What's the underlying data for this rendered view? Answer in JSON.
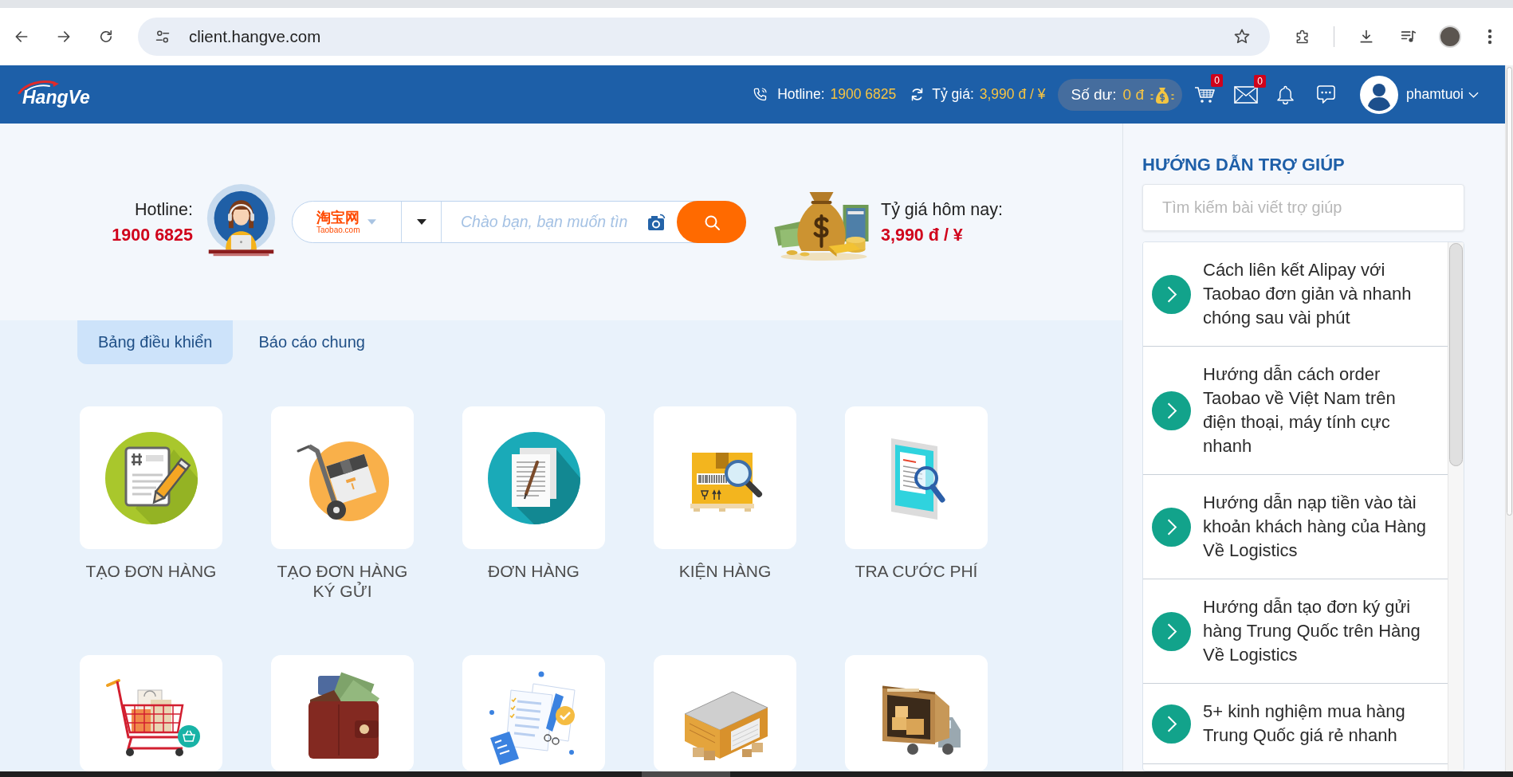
{
  "browser": {
    "url": "client.hangve.com"
  },
  "header": {
    "logo": "HangVe",
    "hotline_label": "Hotline:",
    "hotline": "1900 6825",
    "rate_label": "Tỷ giá:",
    "rate": "3,990 đ / ¥",
    "balance_label": "Số dư:",
    "balance": "0 đ",
    "cart_count": "0",
    "mail_count": "0",
    "username": "phamtuoi"
  },
  "hero": {
    "hotline_label": "Hotline:",
    "hotline": "1900 6825",
    "store_name": "淘宝网",
    "store_domain": "Taobao.com",
    "search_placeholder": "Chào bạn, bạn muốn tìn",
    "rate_label": "Tỷ giá hôm nay:",
    "rate": "3,990 đ / ¥"
  },
  "tabs": [
    {
      "label": "Bảng điều khiển",
      "selected": true
    },
    {
      "label": "Báo cáo chung",
      "selected": false
    }
  ],
  "tiles": [
    {
      "kind": "note",
      "label": "TẠO ĐƠN HÀNG"
    },
    {
      "kind": "hand-truck",
      "label": "TẠO ĐƠN HÀNG KÝ GỬI"
    },
    {
      "kind": "documents",
      "label": "ĐƠN HÀNG"
    },
    {
      "kind": "parcel",
      "label": "KIỆN HÀNG"
    },
    {
      "kind": "tablet",
      "label": "TRA CƯỚC PHÍ"
    },
    {
      "kind": "cart"
    },
    {
      "kind": "wallet"
    },
    {
      "kind": "checklist"
    },
    {
      "kind": "warehouse"
    },
    {
      "kind": "truck"
    }
  ],
  "help": {
    "title": "HƯỚNG DẪN TRỢ GIÚP",
    "search_placeholder": "Tìm kiếm bài viết trợ giúp",
    "articles": [
      "Cách liên kết Alipay với Taobao đơn giản và nhanh chóng sau vài phút",
      "Hướng dẫn cách order Taobao về Việt Nam trên điện thoại, máy tính cực nhanh",
      "Hướng dẫn nạp tiền vào tài khoản khách hàng của Hàng Về Logistics",
      "Hướng dẫn tạo đơn ký gửi hàng Trung Quốc trên Hàng Về Logistics",
      "5+ kinh nghiệm mua hàng Trung Quốc giá rẻ nhanh"
    ]
  }
}
